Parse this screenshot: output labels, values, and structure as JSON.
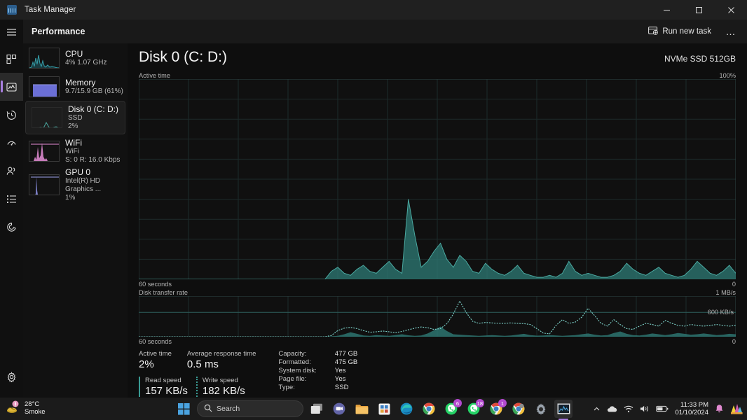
{
  "window": {
    "app_icon": "task-manager-icon",
    "title": "Task Manager",
    "minimize_label": "–",
    "maximize_label": "❑",
    "close_label": "✕"
  },
  "nav_rail": {
    "menu_label": "hamburger-menu",
    "items": [
      {
        "name": "processes",
        "icon": "processes-icon"
      },
      {
        "name": "performance",
        "icon": "performance-icon",
        "selected": true
      },
      {
        "name": "app-history",
        "icon": "history-icon"
      },
      {
        "name": "startup-apps",
        "icon": "startup-icon"
      },
      {
        "name": "users",
        "icon": "users-icon"
      },
      {
        "name": "details",
        "icon": "details-icon"
      },
      {
        "name": "services",
        "icon": "services-icon"
      }
    ],
    "settings": {
      "name": "settings",
      "icon": "gear-icon"
    }
  },
  "header": {
    "title": "Performance",
    "run_new_task": "Run new task",
    "more_options": "…"
  },
  "sidebar": {
    "items": [
      {
        "name": "CPU",
        "line2": "4%  1.07 GHz",
        "line3": "",
        "selected": false
      },
      {
        "name": "Memory",
        "line2": "9.7/15.9 GB (61%)",
        "line3": "",
        "selected": false
      },
      {
        "name": "Disk 0 (C: D:)",
        "line2": "SSD",
        "line3": "2%",
        "selected": true
      },
      {
        "name": "WiFi",
        "line2": "WiFi",
        "line3": "S: 0 R: 16.0 Kbps",
        "selected": false
      },
      {
        "name": "GPU 0",
        "line2": "Intel(R) HD Graphics ...",
        "line3": "1%",
        "selected": false
      }
    ]
  },
  "main": {
    "title": "Disk 0 (C: D:)",
    "device": "NVMe SSD 512GB",
    "chart1": {
      "caption": "Active time",
      "max_label": "100%",
      "x_label": "60 seconds",
      "min_label": "0"
    },
    "chart2": {
      "caption": "Disk transfer rate",
      "max_label": "1 MB/s",
      "mid_label": "600 KB/s",
      "x_label": "60 seconds",
      "min_label": "0"
    },
    "stats": {
      "active_time_label": "Active time",
      "active_time_value": "2%",
      "response_label": "Average response time",
      "response_value": "0.5 ms",
      "read_label": "Read speed",
      "read_value": "157 KB/s",
      "write_label": "Write speed",
      "write_value": "182 KB/s",
      "info": [
        {
          "key": "Capacity:",
          "value": "477 GB"
        },
        {
          "key": "Formatted:",
          "value": "475 GB"
        },
        {
          "key": "System disk:",
          "value": "Yes"
        },
        {
          "key": "Page file:",
          "value": "Yes"
        },
        {
          "key": "Type:",
          "value": "SSD"
        }
      ]
    }
  },
  "taskbar": {
    "weather": {
      "temp": "28°C",
      "condition": "Smoke",
      "icon": "weather-smoke-icon"
    },
    "start": "start-icon",
    "search_placeholder": "Search",
    "search_icon": "search-icon",
    "apps": [
      {
        "name": "task-view",
        "icon": "task-view-icon",
        "badge": ""
      },
      {
        "name": "teams-chat",
        "icon": "teams-icon",
        "badge": ""
      },
      {
        "name": "file-explorer",
        "icon": "folder-icon",
        "badge": ""
      },
      {
        "name": "store",
        "icon": "store-icon",
        "badge": ""
      },
      {
        "name": "edge",
        "icon": "edge-icon",
        "badge": ""
      },
      {
        "name": "chrome",
        "icon": "chrome-icon",
        "badge": ""
      },
      {
        "name": "whatsapp-1",
        "icon": "whatsapp-icon",
        "badge": "6"
      },
      {
        "name": "whatsapp-2",
        "icon": "whatsapp-icon",
        "badge": "18"
      },
      {
        "name": "chrome-app-1",
        "icon": "chrome-icon",
        "badge": "1"
      },
      {
        "name": "chrome-app-2",
        "icon": "chrome-icon",
        "badge": ""
      },
      {
        "name": "settings",
        "icon": "gear-icon",
        "badge": ""
      },
      {
        "name": "task-manager",
        "icon": "task-manager-icon",
        "badge": "",
        "active": true
      }
    ],
    "tray": {
      "overflow": "chevron-up-icon",
      "onedrive": "cloud-icon",
      "wifi": "wifi-icon",
      "volume": "speaker-icon",
      "battery": "battery-icon",
      "time": "11:33 PM",
      "date": "01/10/2024",
      "notifications": "bell-icon",
      "widget": "colorful-app-icon"
    }
  },
  "colors": {
    "accent": "#a97fe0",
    "disk_line": "#4aa8a0",
    "disk_fill": "#2e7b76",
    "cpu_line": "#3fb8c4",
    "memory_fill": "#6b6fd6",
    "wifi_fill": "#e88fd8"
  },
  "chart_data": {
    "type": "area",
    "title": "Disk 0 (C: D:) Active time",
    "charts": [
      {
        "name": "active-time",
        "ylabel": "Active time",
        "ylim": [
          0,
          100
        ],
        "xlabel": "60 seconds",
        "values": [
          0,
          0,
          0,
          0,
          0,
          0,
          0,
          0,
          0,
          0,
          0,
          0,
          0,
          0,
          0,
          0,
          0,
          0,
          0,
          0,
          0,
          0,
          0,
          0,
          0,
          0,
          0,
          0,
          0,
          0,
          4,
          6,
          3,
          2,
          5,
          7,
          4,
          3,
          6,
          9,
          5,
          3,
          40,
          22,
          6,
          9,
          14,
          18,
          10,
          6,
          12,
          9,
          4,
          3,
          8,
          5,
          3,
          2,
          4,
          7,
          3,
          2,
          1,
          1,
          2,
          1,
          3,
          9,
          4,
          2,
          3,
          2,
          1,
          1,
          2,
          4,
          8,
          5,
          3,
          2,
          4,
          6,
          3,
          2,
          1,
          2,
          5,
          9,
          6,
          3,
          2,
          4,
          7,
          3
        ]
      },
      {
        "name": "disk-transfer-rate",
        "ylabel": "Disk transfer rate",
        "ylim": [
          0,
          1000
        ],
        "ymid": 600,
        "xlabel": "60 seconds",
        "series": [
          {
            "name": "read",
            "style": "filled",
            "values": [
              0,
              0,
              0,
              0,
              0,
              0,
              0,
              0,
              0,
              0,
              0,
              0,
              0,
              0,
              0,
              0,
              0,
              0,
              0,
              0,
              0,
              0,
              0,
              0,
              0,
              0,
              0,
              0,
              0,
              0,
              10,
              20,
              60,
              110,
              70,
              30,
              20,
              40,
              30,
              20,
              40,
              60,
              35,
              20,
              30,
              80,
              160,
              250,
              140,
              60,
              50,
              40,
              30,
              20,
              30,
              40,
              30,
              20,
              30,
              50,
              70,
              40,
              25,
              30,
              40,
              30,
              20,
              30,
              40,
              60,
              80,
              50,
              30,
              40,
              90,
              130,
              70,
              40,
              30,
              50,
              80,
              60,
              40,
              60,
              90,
              70,
              50,
              60,
              80,
              60,
              40,
              50,
              70,
              60
            ]
          },
          {
            "name": "write",
            "style": "dotted",
            "values": [
              0,
              0,
              0,
              0,
              0,
              0,
              0,
              0,
              0,
              0,
              0,
              0,
              0,
              0,
              0,
              0,
              0,
              0,
              0,
              0,
              0,
              0,
              0,
              0,
              0,
              0,
              0,
              0,
              0,
              0,
              30,
              150,
              210,
              230,
              200,
              150,
              110,
              120,
              140,
              120,
              100,
              130,
              170,
              210,
              240,
              220,
              180,
              200,
              320,
              560,
              880,
              600,
              380,
              330,
              350,
              340,
              330,
              330,
              340,
              330,
              320,
              300,
              200,
              90,
              70,
              280,
              420,
              330,
              360,
              480,
              700,
              520,
              330,
              260,
              420,
              300,
              200,
              180,
              260,
              330,
              300,
              260,
              400,
              330,
              280,
              260,
              300,
              280,
              260,
              280,
              300,
              280,
              260,
              280
            ]
          }
        ]
      }
    ]
  }
}
